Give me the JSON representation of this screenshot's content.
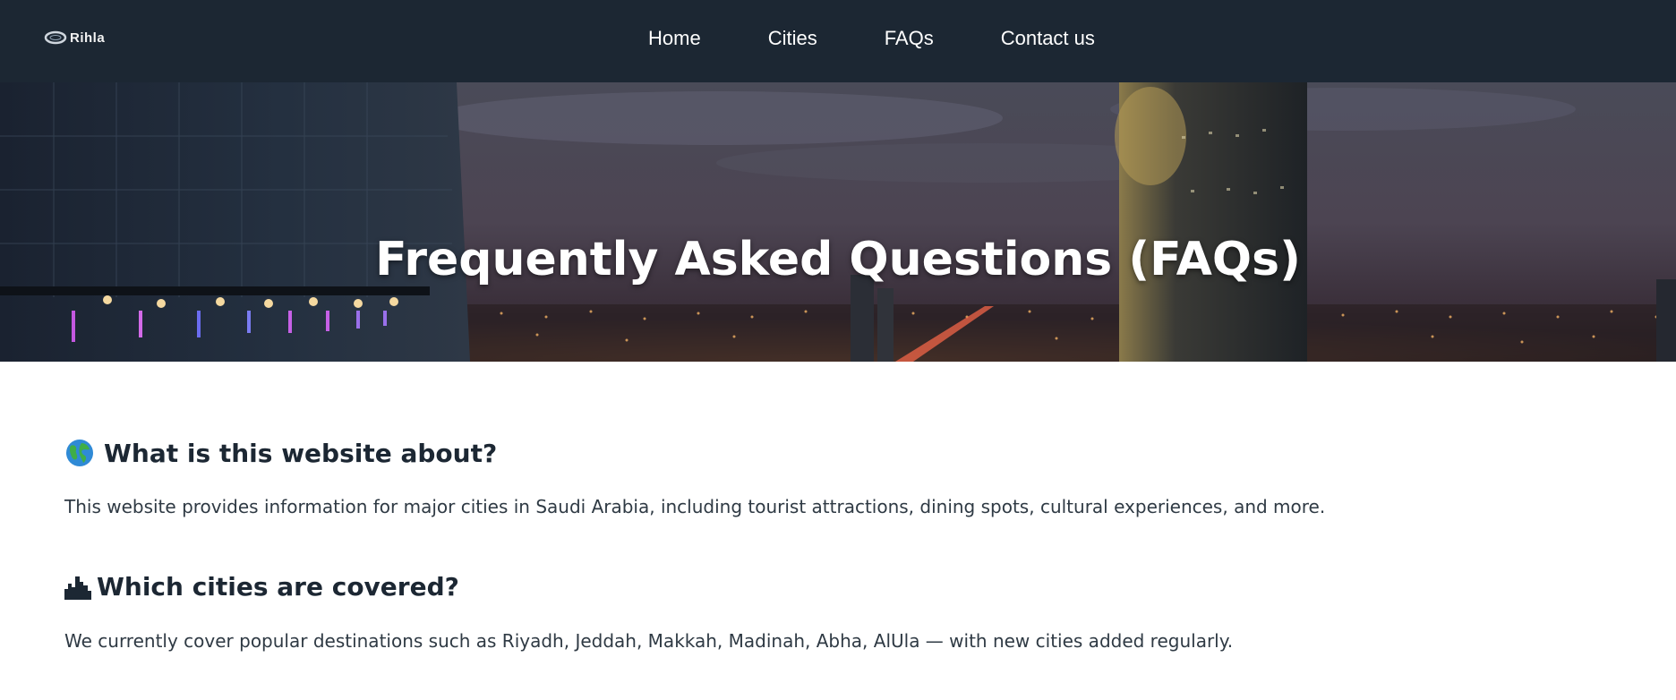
{
  "brand": {
    "name": "Rihla",
    "logo_icon": "ring-icon"
  },
  "nav": {
    "items": [
      {
        "label": "Home"
      },
      {
        "label": "Cities"
      },
      {
        "label": "FAQs"
      },
      {
        "label": "Contact us"
      }
    ]
  },
  "hero": {
    "title": "Frequently Asked Questions (FAQs)",
    "background": "night-city-skyline-photo"
  },
  "faqs": [
    {
      "icon": "globe-icon",
      "question": "What is this website about?",
      "answer": "This website provides information for major cities in Saudi Arabia, including tourist attractions, dining spots, cultural experiences, and more."
    },
    {
      "icon": "city-icon",
      "question": "Which cities are covered?",
      "answer": "We currently cover popular destinations such as Riyadh, Jeddah, Makkah, Madinah, Abha, AlUla — with new cities added regularly."
    }
  ],
  "colors": {
    "navbar": "#1c2733",
    "heading": "#1c2733",
    "body_text": "#2f3a44"
  }
}
